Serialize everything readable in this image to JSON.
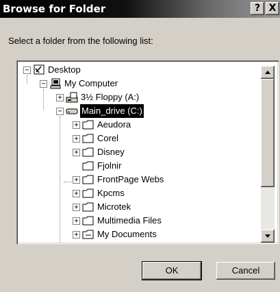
{
  "window": {
    "title": "Browse for Folder",
    "help_label": "?",
    "close_label": "X"
  },
  "prompt": "Select a folder from the following list:",
  "tree": [
    {
      "label": "Desktop",
      "icon": "desktop-icon",
      "expander": "−"
    },
    {
      "label": "My Computer",
      "icon": "computer-icon",
      "expander": "−"
    },
    {
      "label": "3½ Floppy (A:)",
      "icon": "floppy-drive-icon",
      "expander": "+"
    },
    {
      "label": "Main_drive (C:)",
      "icon": "hard-drive-icon",
      "expander": "−",
      "selected": true
    },
    {
      "label": "Aeudora",
      "icon": "folder-icon",
      "expander": "+"
    },
    {
      "label": "Corel",
      "icon": "folder-icon",
      "expander": "+"
    },
    {
      "label": "Disney",
      "icon": "folder-icon",
      "expander": "+"
    },
    {
      "label": "Fjolnir",
      "icon": "folder-icon",
      "expander": ""
    },
    {
      "label": "FrontPage Webs",
      "icon": "folder-icon",
      "expander": "+"
    },
    {
      "label": "Kpcms",
      "icon": "folder-icon",
      "expander": "+"
    },
    {
      "label": "Microtek",
      "icon": "folder-icon",
      "expander": "+"
    },
    {
      "label": "Multimedia Files",
      "icon": "folder-icon",
      "expander": "+"
    },
    {
      "label": "My Documents",
      "icon": "my-documents-folder-icon",
      "expander": "+"
    }
  ],
  "buttons": {
    "ok": "OK",
    "cancel": "Cancel"
  },
  "colors": {
    "selection": "#000000",
    "face": "#d4d0c8",
    "titlebar": "#000000"
  }
}
